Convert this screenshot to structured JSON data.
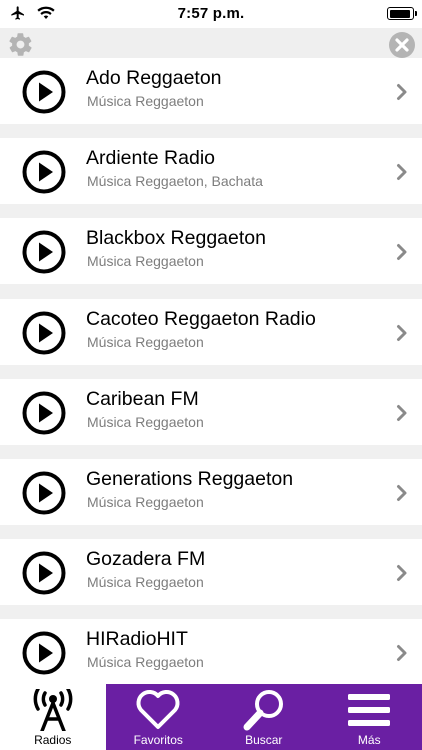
{
  "status_bar": {
    "time": "7:57 p.m.",
    "battery_level": 0.92
  },
  "header": {
    "settings_icon": "gear-icon",
    "close_icon": "close-icon"
  },
  "stations": [
    {
      "name": "Ado Reggaeton",
      "genre": "Música Reggaeton"
    },
    {
      "name": "Ardiente Radio",
      "genre": "Música Reggaeton, Bachata"
    },
    {
      "name": "Blackbox Reggaeton",
      "genre": "Música Reggaeton"
    },
    {
      "name": "Cacoteo Reggaeton Radio",
      "genre": "Música Reggaeton"
    },
    {
      "name": "Caribean FM",
      "genre": "Música Reggaeton"
    },
    {
      "name": "Generations Reggaeton",
      "genre": "Música Reggaeton"
    },
    {
      "name": "Gozadera FM",
      "genre": "Música Reggaeton"
    },
    {
      "name": "HIRadioHIT",
      "genre": "Música Reggaeton"
    }
  ],
  "tabs": [
    {
      "label": "Radios",
      "icon": "antenna-icon",
      "active": true
    },
    {
      "label": "Favoritos",
      "icon": "heart-icon",
      "active": false
    },
    {
      "label": "Buscar",
      "icon": "magnifier-icon",
      "active": false
    },
    {
      "label": "Más",
      "icon": "menu-icon",
      "active": false
    }
  ],
  "colors": {
    "tab_bar": "#6a1fa3",
    "background": "#f0f0f0",
    "genre_text": "#7d7d7d"
  }
}
